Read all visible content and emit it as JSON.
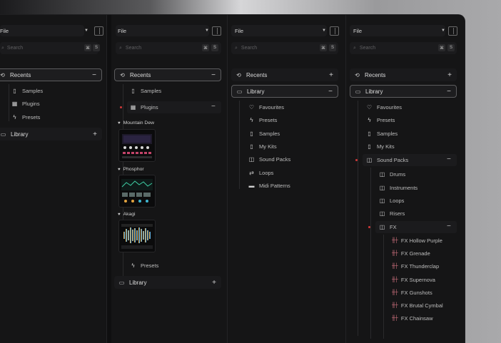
{
  "file_label": "File",
  "search_placeholder": "Search",
  "kbd": [
    "⌘",
    "S"
  ],
  "recents": "Recents",
  "library": "Library",
  "samples": "Samples",
  "plugins": "Plugins",
  "presets": "Presets",
  "plugin_list": [
    "Mountain Dew",
    "Phosphor",
    "Akagi"
  ],
  "lib_items": [
    "Favourites",
    "Presets",
    "Samples",
    "My Kits",
    "Sound Packs",
    "Loops",
    "Midi Patterns"
  ],
  "lib_items_4": [
    "Favourites",
    "Presets",
    "Samples",
    "My Kits"
  ],
  "sound_packs": "Sound Packs",
  "sp_items": [
    "Drums",
    "Instruments",
    "Loops",
    "Risers"
  ],
  "fx": "FX",
  "fx_items": [
    "FX Hollow Purple",
    "FX Grenade",
    "FX Thunderclap",
    "FX Supernova",
    "FX Gunshots",
    "FX Brutal Cymbal",
    "FX Chainsaw"
  ],
  "colors": {
    "accent_dot": "#d13a3a",
    "wave": "#e07a88"
  }
}
